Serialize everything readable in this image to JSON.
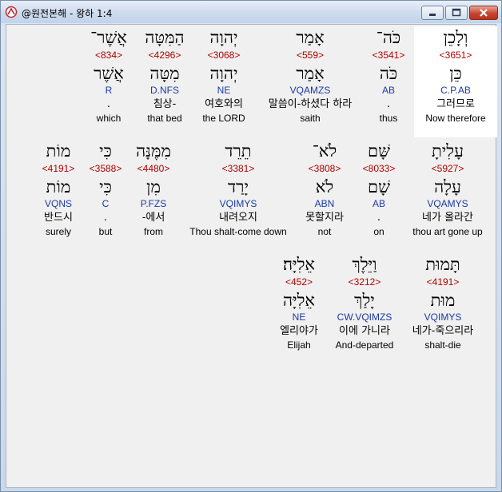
{
  "window": {
    "title": "@원전본해 - 왕하 1:4",
    "buttons": {
      "minimize": "minimize-icon",
      "maximize": "maximize-icon",
      "close": "close-icon"
    }
  },
  "colors": {
    "strong": "#b00000",
    "morph": "#1a3aa8",
    "highlight": "#ffffff"
  },
  "rows": [
    {
      "words": [
        {
          "hebrew": "וְלָכֵן",
          "strong": "<3651>",
          "root": "כֵּן",
          "morph": "C.P.AB",
          "korean": "그러므로",
          "english": "Now therefore",
          "highlight": true
        },
        {
          "hebrew": "כֹּה־",
          "strong": "<3541>",
          "root": "כֹּה",
          "morph": "AB",
          "korean": ".",
          "english": "thus"
        },
        {
          "hebrew": "אָמַר",
          "strong": "<559>",
          "root": "אָמַר",
          "morph": "VQAMZS",
          "korean": "말씀이-하셨다 하라",
          "english": "saith"
        },
        {
          "hebrew": "יְהוָה",
          "strong": "<3068>",
          "root": "יְהוָה",
          "morph": "NE",
          "korean": "여호와의",
          "english": "the LORD"
        },
        {
          "hebrew": "הַמִּטָּה",
          "strong": "<4296>",
          "root": "מִטָּה",
          "morph": "D.NFS",
          "korean": "침상-",
          "english": "that bed"
        },
        {
          "hebrew": "אֲשֶׁר־",
          "strong": "<834>",
          "root": "אֲשֶׁר",
          "morph": "R",
          "korean": ".",
          "english": "which"
        }
      ]
    },
    {
      "words": [
        {
          "hebrew": "עָלִיתָ",
          "strong": "<5927>",
          "root": "עָלָה",
          "morph": "VQAMYS",
          "korean": "네가 올라간",
          "english": "thou art gone up"
        },
        {
          "hebrew": "שָּׁם",
          "strong": "<8033>",
          "root": "שָׁם",
          "morph": "AB",
          "korean": ".",
          "english": "on"
        },
        {
          "hebrew": "לֹא־",
          "strong": "<3808>",
          "root": "לֹא",
          "morph": "ABN",
          "korean": "못할지라",
          "english": "not"
        },
        {
          "hebrew": "תֵרֵד",
          "strong": "<3381>",
          "root": "יָרַד",
          "morph": "VQIMYS",
          "korean": "내려오지",
          "english": "Thou shalt-come down"
        },
        {
          "hebrew": "מִמֶּנָּה",
          "strong": "<4480>",
          "root": "מִן",
          "morph": "P.FZS",
          "korean": "-에서",
          "english": "from"
        },
        {
          "hebrew": "כִּי",
          "strong": "<3588>",
          "root": "כִּי",
          "morph": "C",
          "korean": ".",
          "english": "but"
        },
        {
          "hebrew": "מוֹת",
          "strong": "<4191>",
          "root": "מוֹת",
          "morph": "VQNS",
          "korean": "반드시",
          "english": "surely"
        }
      ]
    },
    {
      "words": [
        {
          "hebrew": "תָּמוּת",
          "strong": "<4191>",
          "root": "מוּת",
          "morph": "VQIMYS",
          "korean": "네가-죽으리라",
          "english": "shalt-die"
        },
        {
          "hebrew": "וַיֵּלֶךְ",
          "strong": "<3212>",
          "root": "יָלַךְ",
          "morph": "CW.VQIMZS",
          "korean": "이에 가니라",
          "english": "And-departed"
        },
        {
          "hebrew": "אֵלִיָּה׃",
          "strong": "<452>",
          "root": "אֵלִיָּה",
          "morph": "NE",
          "korean": "엘리야가",
          "english": "Elijah"
        }
      ]
    }
  ]
}
